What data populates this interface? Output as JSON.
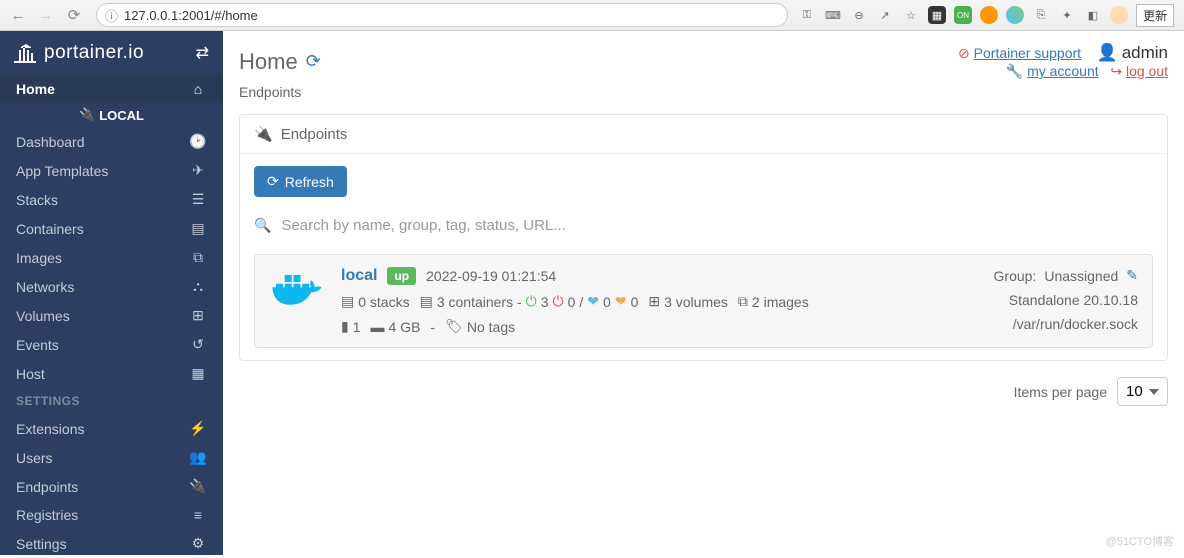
{
  "browser": {
    "url": "127.0.0.1:2001/#/home",
    "update_label": "更新"
  },
  "brand": "portainer.io",
  "sidebar": {
    "home": "Home",
    "local": "LOCAL",
    "items": [
      {
        "label": "Dashboard",
        "icon": "tachometer"
      },
      {
        "label": "App Templates",
        "icon": "rocket"
      },
      {
        "label": "Stacks",
        "icon": "th-list"
      },
      {
        "label": "Containers",
        "icon": "server"
      },
      {
        "label": "Images",
        "icon": "clone"
      },
      {
        "label": "Networks",
        "icon": "sitemap"
      },
      {
        "label": "Volumes",
        "icon": "hdd"
      },
      {
        "label": "Events",
        "icon": "history"
      },
      {
        "label": "Host",
        "icon": "th"
      }
    ],
    "settings_label": "SETTINGS",
    "settings": [
      {
        "label": "Extensions",
        "icon": "bolt"
      },
      {
        "label": "Users",
        "icon": "users"
      },
      {
        "label": "Endpoints",
        "icon": "plug"
      },
      {
        "label": "Registries",
        "icon": "database"
      },
      {
        "label": "Settings",
        "icon": "cogs"
      }
    ]
  },
  "header": {
    "title": "Home",
    "breadcrumb": "Endpoints",
    "support": "Portainer support",
    "user": "admin",
    "account": "my account",
    "logout": "log out"
  },
  "widget_title": "Endpoints",
  "refresh_btn": "Refresh",
  "search_placeholder": "Search by name, group, tag, status, URL...",
  "endpoint": {
    "name": "local",
    "status": "up",
    "snapshot_time": "2022-09-19 01:21:54",
    "group_label": "Group:",
    "group_value": "Unassigned",
    "stacks": "0 stacks",
    "containers": "3 containers -",
    "power_on": "3",
    "power_off": "0",
    "healthy": "0",
    "unhealthy": "0",
    "volumes": "3 volumes",
    "images": "2 images",
    "cpu": "1",
    "mem": "4 GB",
    "dash": "-",
    "tags": "No tags",
    "type": "Standalone 20.10.18",
    "socket": "/var/run/docker.sock"
  },
  "pager": {
    "label": "Items per page",
    "value": "10"
  },
  "watermark": "@51CTO博客"
}
